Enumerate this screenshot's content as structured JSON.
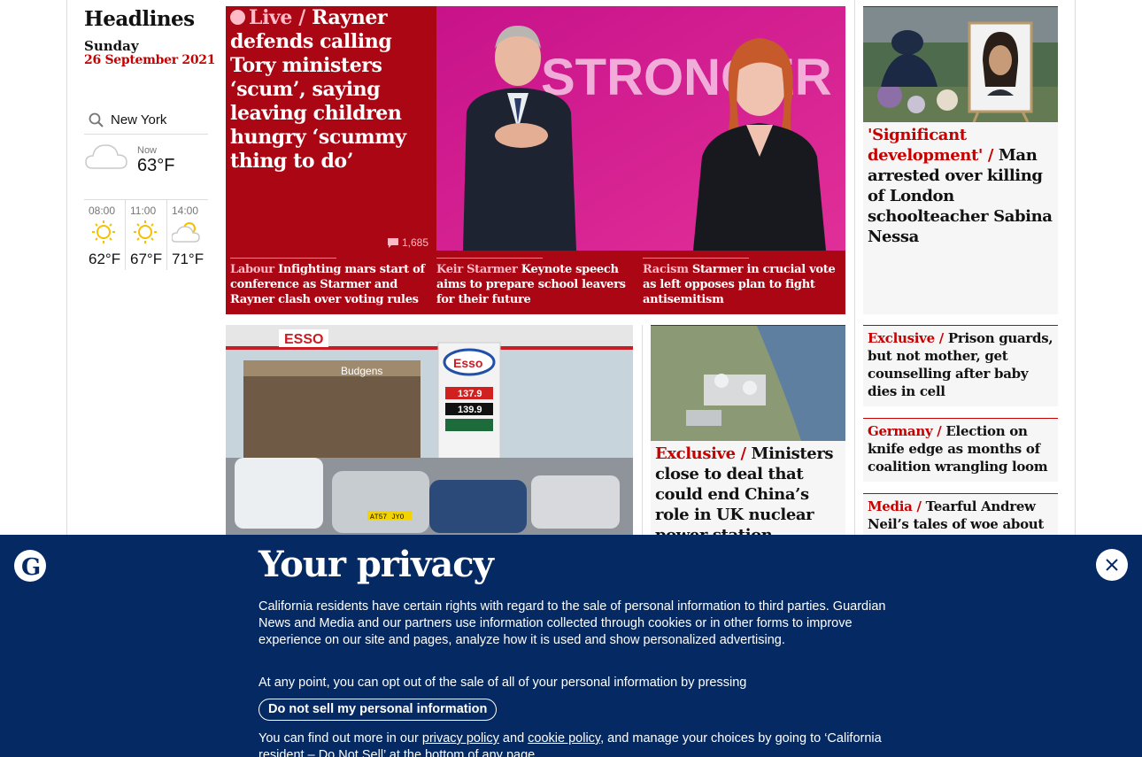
{
  "headlines": {
    "title": "Headlines",
    "day": "Sunday",
    "date": "26 September 2021"
  },
  "weather": {
    "location": "New York",
    "now_label": "Now",
    "now_temp": "63°F",
    "now_icon": "cloud-icon",
    "forecast": [
      {
        "time": "08:00",
        "temp": "62°F",
        "icon": "sun-icon"
      },
      {
        "time": "11:00",
        "temp": "67°F",
        "icon": "sun-icon"
      },
      {
        "time": "14:00",
        "temp": "71°F",
        "icon": "sun-cloud-icon"
      }
    ]
  },
  "lead": {
    "kicker": "Live /",
    "headline": "Rayner defends calling Tory ministers ‘scum’, saying leaving children hungry ‘scummy thing to do’",
    "comments": "1,685",
    "image_text": "STRONGER",
    "sublinks": [
      {
        "kicker": "Labour",
        "text": "Infighting mars start of conference as Starmer and Rayner clash over voting rules"
      },
      {
        "kicker": "Keir Starmer",
        "text": "Keynote speech aims to prepare school leavers for their future"
      },
      {
        "kicker": "Racism",
        "text": "Starmer in crucial vote as left opposes plan to fight antisemitism"
      }
    ]
  },
  "right_card": {
    "kicker": "'Significant development' /",
    "headline": "Man arrested over killing of London schoolteacher Sabina Nessa"
  },
  "small_stories": [
    {
      "kicker": "Exclusive /",
      "text": "Prison guards, but not mother, get counselling after baby dies in cell"
    },
    {
      "kicker": "Germany /",
      "text": "Election on knife edge as months of coalition wrangling loom"
    },
    {
      "kicker": "Media /",
      "text": "Tearful Andrew Neil’s tales of woe about GB News show ambition"
    }
  ],
  "petrol_image": {
    "sign_text": "ESSO",
    "shop_text": "Budgens",
    "price_1": "137.9",
    "price_2": "139.9",
    "plate": "AT57 JYO"
  },
  "nuclear": {
    "kicker": "Exclusive /",
    "headline": "Ministers close to deal that could end China’s role in UK nuclear power station"
  },
  "privacy": {
    "title": "Your privacy",
    "p1": "California residents have certain rights with regard to the sale of personal information to third parties. Guardian News and Media and our partners use information collected through cookies or in other forms to improve experience on our site and pages, analyze how it is used and show personalized advertising.",
    "p2": "At any point, you can opt out of the sale of all of your personal information by pressing",
    "button": "Do not sell my personal information",
    "p3_start": "You can find out more in our ",
    "privacy_link": "privacy policy",
    "p3_and": " and ",
    "cookie_link": "cookie policy",
    "p3_end": ", and manage your choices by going to ‘California resident – Do Not Sell’ at the bottom of any page."
  },
  "colors": {
    "news_red": "#c70000",
    "live_bg": "#ab0613",
    "live_pink": "#ffbac8",
    "banner_blue": "#052962"
  }
}
